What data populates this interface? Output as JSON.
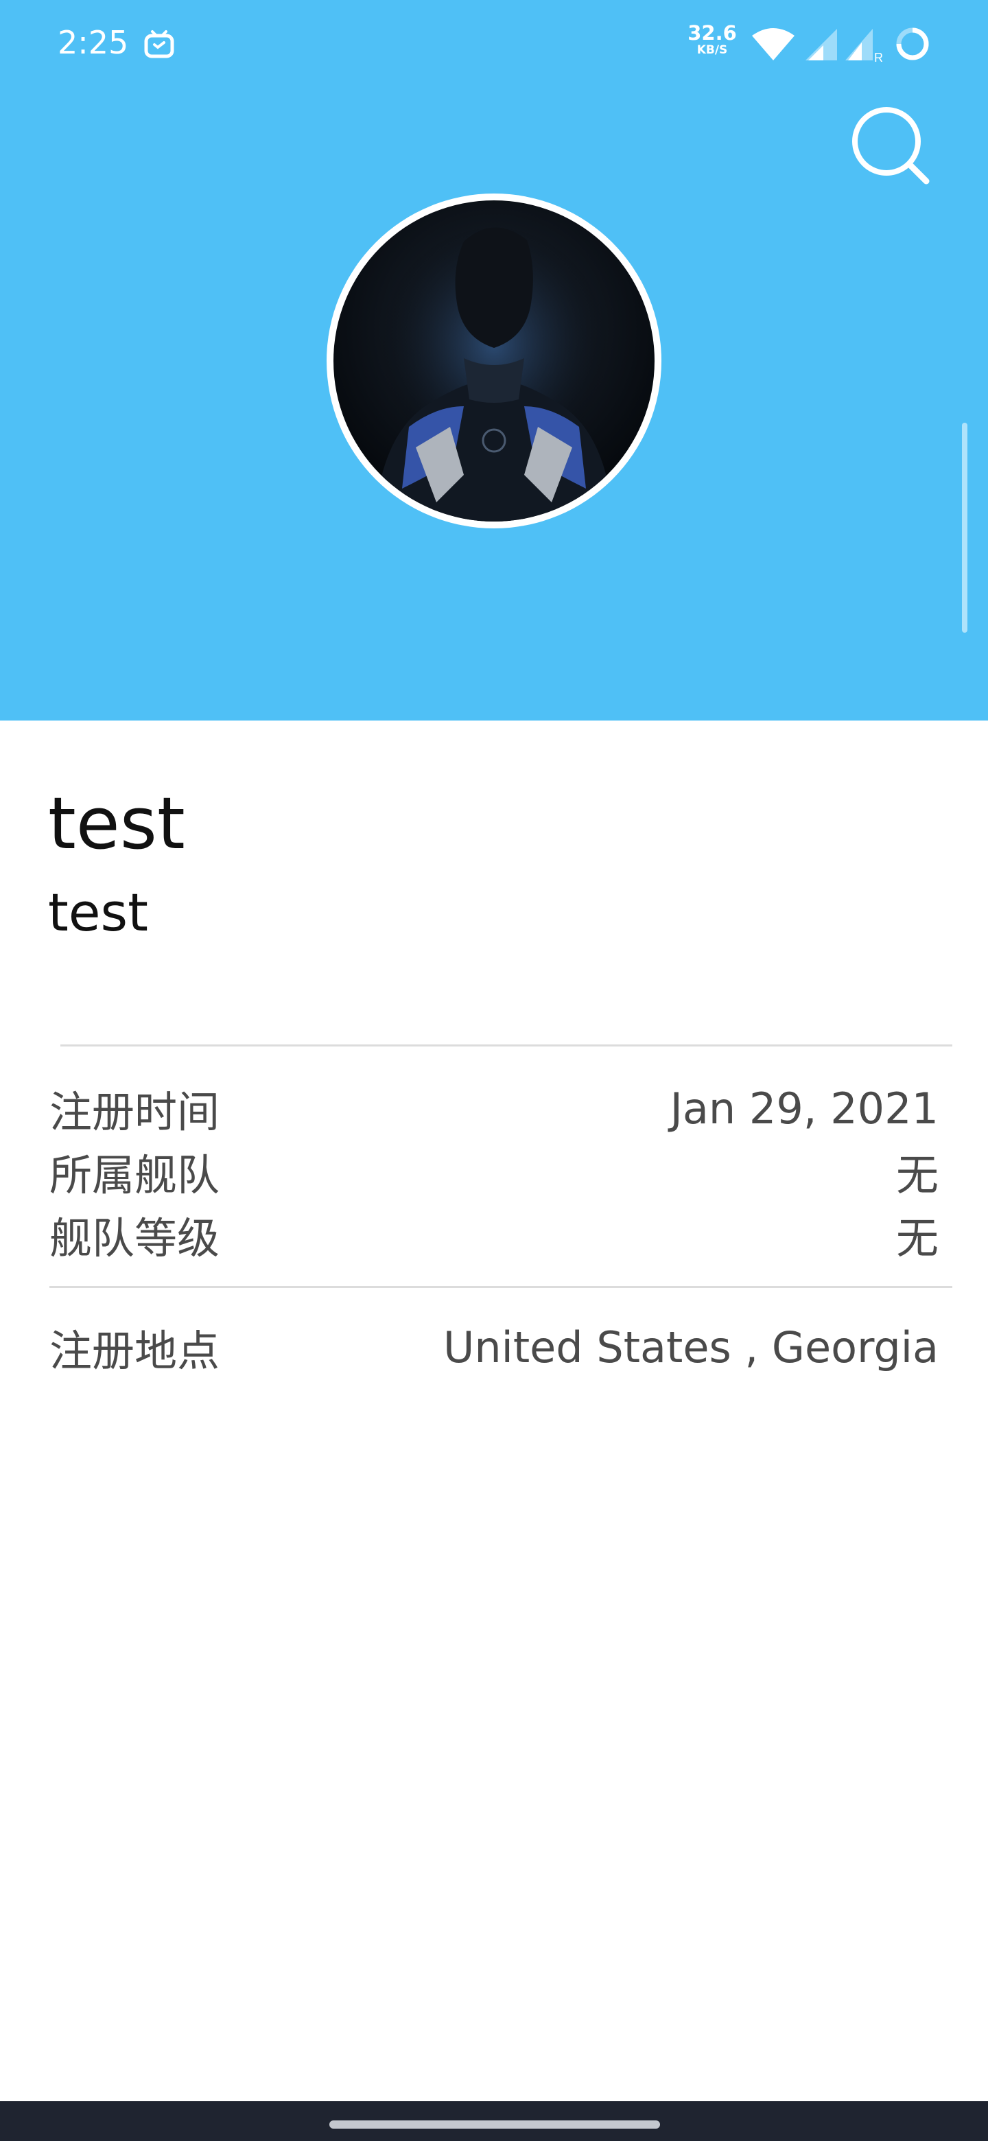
{
  "status_bar": {
    "time": "2:25",
    "net_speed_value": "32.6",
    "net_speed_unit": "KB/S",
    "icons": [
      "tv-icon",
      "wifi-icon",
      "cell-signal-icon",
      "cell-signal-roaming-icon",
      "loading-spinner-icon"
    ]
  },
  "header": {
    "background_color": "#4fc0f6",
    "search_icon": "search-icon",
    "avatar": "profile-avatar"
  },
  "profile": {
    "display_name": "test",
    "username": "test"
  },
  "info": {
    "rows": [
      {
        "label": "注册时间",
        "value": "Jan 29, 2021"
      },
      {
        "label": "所属舰队",
        "value": "无"
      },
      {
        "label": "舰队等级",
        "value": "无"
      }
    ],
    "location": {
      "label": "注册地点",
      "value": "United States , Georgia"
    }
  }
}
